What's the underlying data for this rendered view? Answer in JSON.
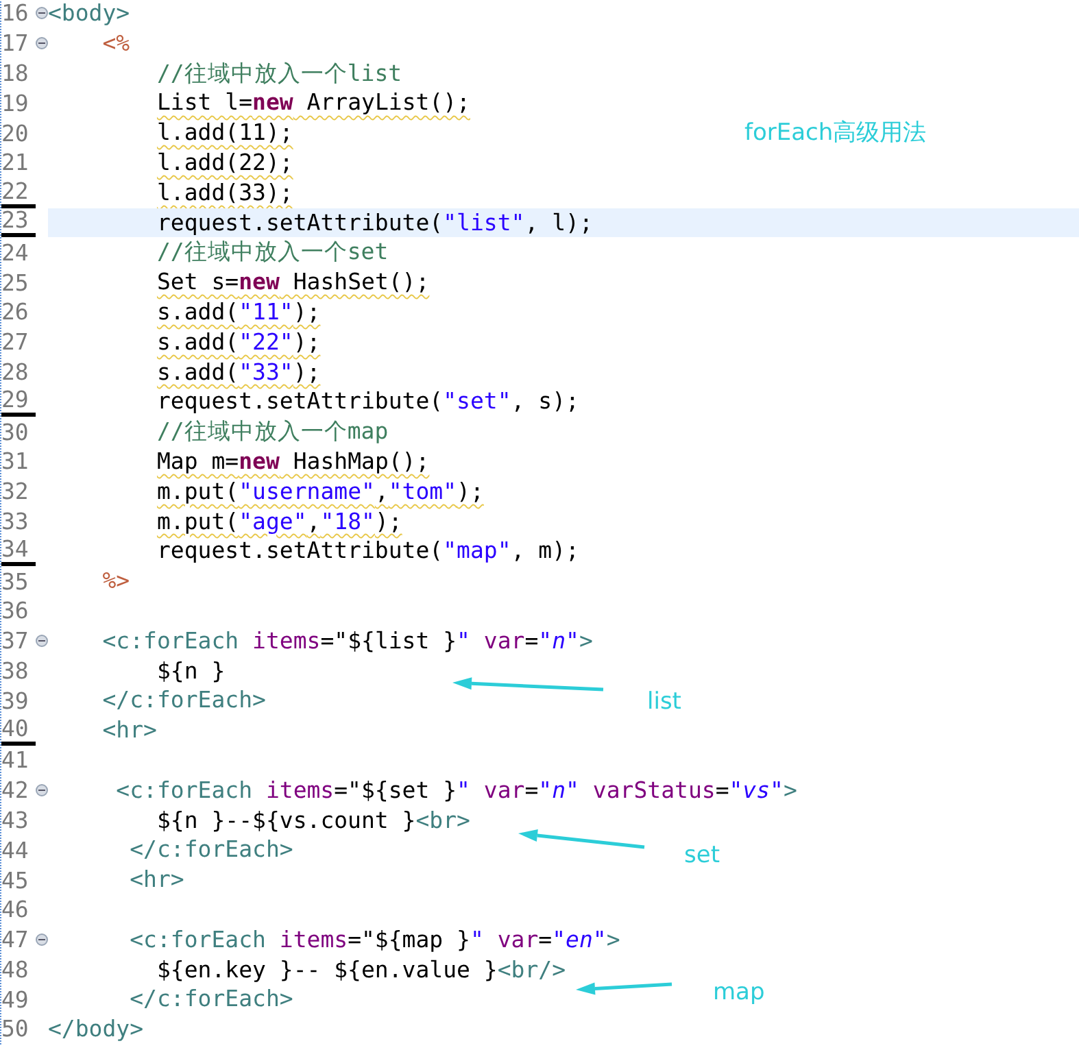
{
  "editor": {
    "lines": [
      {
        "number": "16",
        "foldable": true,
        "current": false,
        "marked": false,
        "warning": false,
        "tokens": [
          {
            "kind": "tag",
            "text": "<body>"
          }
        ]
      },
      {
        "number": "17",
        "foldable": true,
        "current": false,
        "marked": false,
        "warning": false,
        "tokens": [
          {
            "kind": "jsp",
            "text": "    <%"
          }
        ]
      },
      {
        "number": "18",
        "foldable": false,
        "current": false,
        "marked": false,
        "warning": false,
        "tokens": [
          {
            "kind": "comment",
            "text": "        //往域中放入一个list"
          }
        ]
      },
      {
        "number": "19",
        "foldable": false,
        "current": false,
        "marked": false,
        "warning": true,
        "tokens": [
          {
            "kind": "plain",
            "text": "        List l="
          },
          {
            "kind": "keyword",
            "text": "new"
          },
          {
            "kind": "plain",
            "text": " ArrayList();"
          }
        ]
      },
      {
        "number": "20",
        "foldable": false,
        "current": false,
        "marked": false,
        "warning": true,
        "tokens": [
          {
            "kind": "plain",
            "text": "        l.add(11);"
          }
        ]
      },
      {
        "number": "21",
        "foldable": false,
        "current": false,
        "marked": false,
        "warning": true,
        "tokens": [
          {
            "kind": "plain",
            "text": "        l.add(22);"
          }
        ]
      },
      {
        "number": "22",
        "foldable": false,
        "current": false,
        "marked": true,
        "warning": true,
        "tokens": [
          {
            "kind": "plain",
            "text": "        l.add(33);"
          }
        ]
      },
      {
        "number": "23",
        "foldable": false,
        "current": true,
        "marked": true,
        "warning": false,
        "tokens": [
          {
            "kind": "plain",
            "text": "        request.setAttribute("
          },
          {
            "kind": "string",
            "text": "\"list\""
          },
          {
            "kind": "plain",
            "text": ", l);"
          }
        ]
      },
      {
        "number": "24",
        "foldable": false,
        "current": false,
        "marked": false,
        "warning": false,
        "tokens": [
          {
            "kind": "comment",
            "text": "        //往域中放入一个set"
          }
        ]
      },
      {
        "number": "25",
        "foldable": false,
        "current": false,
        "marked": false,
        "warning": true,
        "tokens": [
          {
            "kind": "plain",
            "text": "        Set s="
          },
          {
            "kind": "keyword",
            "text": "new"
          },
          {
            "kind": "plain",
            "text": " HashSet();"
          }
        ]
      },
      {
        "number": "26",
        "foldable": false,
        "current": false,
        "marked": false,
        "warning": true,
        "tokens": [
          {
            "kind": "plain",
            "text": "        s.add("
          },
          {
            "kind": "string",
            "text": "\"11\""
          },
          {
            "kind": "plain",
            "text": ");"
          }
        ]
      },
      {
        "number": "27",
        "foldable": false,
        "current": false,
        "marked": false,
        "warning": true,
        "tokens": [
          {
            "kind": "plain",
            "text": "        s.add("
          },
          {
            "kind": "string",
            "text": "\"22\""
          },
          {
            "kind": "plain",
            "text": ");"
          }
        ]
      },
      {
        "number": "28",
        "foldable": false,
        "current": false,
        "marked": false,
        "warning": true,
        "tokens": [
          {
            "kind": "plain",
            "text": "        s.add("
          },
          {
            "kind": "string",
            "text": "\"33\""
          },
          {
            "kind": "plain",
            "text": ");"
          }
        ]
      },
      {
        "number": "29",
        "foldable": false,
        "current": false,
        "marked": true,
        "warning": false,
        "tokens": [
          {
            "kind": "plain",
            "text": "        request.setAttribute("
          },
          {
            "kind": "string",
            "text": "\"set\""
          },
          {
            "kind": "plain",
            "text": ", s);"
          }
        ]
      },
      {
        "number": "30",
        "foldable": false,
        "current": false,
        "marked": false,
        "warning": false,
        "tokens": [
          {
            "kind": "comment",
            "text": "        //往域中放入一个map"
          }
        ]
      },
      {
        "number": "31",
        "foldable": false,
        "current": false,
        "marked": false,
        "warning": true,
        "tokens": [
          {
            "kind": "plain",
            "text": "        Map m="
          },
          {
            "kind": "keyword",
            "text": "new"
          },
          {
            "kind": "plain",
            "text": " HashMap();"
          }
        ]
      },
      {
        "number": "32",
        "foldable": false,
        "current": false,
        "marked": false,
        "warning": true,
        "tokens": [
          {
            "kind": "plain",
            "text": "        m.put("
          },
          {
            "kind": "string",
            "text": "\"username\""
          },
          {
            "kind": "plain",
            "text": ","
          },
          {
            "kind": "string",
            "text": "\"tom\""
          },
          {
            "kind": "plain",
            "text": ");"
          }
        ]
      },
      {
        "number": "33",
        "foldable": false,
        "current": false,
        "marked": false,
        "warning": true,
        "tokens": [
          {
            "kind": "plain",
            "text": "        m.put("
          },
          {
            "kind": "string",
            "text": "\"age\""
          },
          {
            "kind": "plain",
            "text": ","
          },
          {
            "kind": "string",
            "text": "\"18\""
          },
          {
            "kind": "plain",
            "text": ");"
          }
        ]
      },
      {
        "number": "34",
        "foldable": false,
        "current": false,
        "marked": true,
        "warning": false,
        "tokens": [
          {
            "kind": "plain",
            "text": "        request.setAttribute("
          },
          {
            "kind": "string",
            "text": "\"map\""
          },
          {
            "kind": "plain",
            "text": ", m);"
          }
        ]
      },
      {
        "number": "35",
        "foldable": false,
        "current": false,
        "marked": false,
        "warning": false,
        "tokens": [
          {
            "kind": "jsp",
            "text": "    %>"
          }
        ]
      },
      {
        "number": "36",
        "foldable": false,
        "current": false,
        "marked": false,
        "warning": false
      },
      {
        "number": "37",
        "foldable": true,
        "current": false,
        "marked": false,
        "warning": false,
        "tokens": [
          {
            "kind": "tag",
            "text": "    <c:forEach"
          },
          {
            "kind": "attr",
            "text": " items"
          },
          {
            "kind": "plain",
            "text": "=\"${list }"
          },
          {
            "kind": "value",
            "text": "\""
          },
          {
            "kind": "attr",
            "text": " var"
          },
          {
            "kind": "plain",
            "text": "="
          },
          {
            "kind": "value",
            "text": "\"n\""
          },
          {
            "kind": "tag",
            "text": ">"
          }
        ]
      },
      {
        "number": "38",
        "foldable": false,
        "current": false,
        "marked": false,
        "warning": false,
        "tokens": [
          {
            "kind": "plain",
            "text": "        ${n }"
          }
        ]
      },
      {
        "number": "39",
        "foldable": false,
        "current": false,
        "marked": false,
        "warning": false,
        "tokens": [
          {
            "kind": "tag",
            "text": "    </c:forEach>"
          }
        ]
      },
      {
        "number": "40",
        "foldable": false,
        "current": false,
        "marked": true,
        "warning": false,
        "tokens": [
          {
            "kind": "tag",
            "text": "    <hr>"
          }
        ]
      },
      {
        "number": "41",
        "foldable": false,
        "current": false,
        "marked": false,
        "warning": false
      },
      {
        "number": "42",
        "foldable": true,
        "current": false,
        "marked": false,
        "warning": false,
        "tokens": [
          {
            "kind": "tag",
            "text": "     <c:forEach"
          },
          {
            "kind": "attr",
            "text": " items"
          },
          {
            "kind": "plain",
            "text": "=\"${set }"
          },
          {
            "kind": "value",
            "text": "\""
          },
          {
            "kind": "attr",
            "text": " var"
          },
          {
            "kind": "plain",
            "text": "="
          },
          {
            "kind": "value",
            "text": "\"n\""
          },
          {
            "kind": "attr",
            "text": " varStatus"
          },
          {
            "kind": "plain",
            "text": "="
          },
          {
            "kind": "value",
            "text": "\"vs\""
          },
          {
            "kind": "tag",
            "text": ">"
          }
        ]
      },
      {
        "number": "43",
        "foldable": false,
        "current": false,
        "marked": false,
        "warning": false,
        "tokens": [
          {
            "kind": "plain",
            "text": "        ${n }--${vs.count }"
          },
          {
            "kind": "tag",
            "text": "<br>"
          }
        ]
      },
      {
        "number": "44",
        "foldable": false,
        "current": false,
        "marked": false,
        "warning": false,
        "tokens": [
          {
            "kind": "tag",
            "text": "      </c:forEach>"
          }
        ]
      },
      {
        "number": "45",
        "foldable": false,
        "current": false,
        "marked": false,
        "warning": false,
        "tokens": [
          {
            "kind": "tag",
            "text": "      <hr>"
          }
        ]
      },
      {
        "number": "46",
        "foldable": false,
        "current": false,
        "marked": false,
        "warning": false
      },
      {
        "number": "47",
        "foldable": true,
        "current": false,
        "marked": false,
        "warning": false,
        "tokens": [
          {
            "kind": "tag",
            "text": "      <c:forEach"
          },
          {
            "kind": "attr",
            "text": " items"
          },
          {
            "kind": "plain",
            "text": "=\"${map }"
          },
          {
            "kind": "value",
            "text": "\""
          },
          {
            "kind": "attr",
            "text": " var"
          },
          {
            "kind": "plain",
            "text": "="
          },
          {
            "kind": "value",
            "text": "\"en\""
          },
          {
            "kind": "tag",
            "text": ">"
          }
        ]
      },
      {
        "number": "48",
        "foldable": false,
        "current": false,
        "marked": false,
        "warning": false,
        "tokens": [
          {
            "kind": "plain",
            "text": "        ${en.key }-- ${en.value }"
          },
          {
            "kind": "tag",
            "text": "<br/>"
          }
        ]
      },
      {
        "number": "49",
        "foldable": false,
        "current": false,
        "marked": false,
        "warning": false,
        "tokens": [
          {
            "kind": "tag",
            "text": "      </c:forEach>"
          }
        ]
      },
      {
        "number": "50",
        "foldable": false,
        "current": false,
        "marked": false,
        "warning": false,
        "tokens": [
          {
            "kind": "tag",
            "text": "</body>"
          }
        ]
      }
    ]
  },
  "annotations": [
    {
      "kind": "title",
      "text": "forEach高级用法"
    },
    {
      "kind": "arrow-label",
      "text": "list"
    },
    {
      "kind": "arrow-label",
      "text": "set"
    },
    {
      "kind": "arrow-label",
      "text": "map"
    }
  ]
}
